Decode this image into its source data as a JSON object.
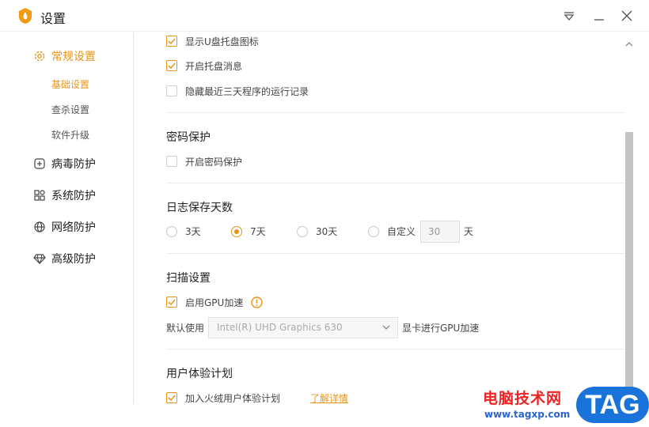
{
  "window": {
    "title": "设置",
    "menu_icon": "menu-triangle-icon",
    "minimize_icon": "minimize-icon",
    "close_icon": "close-icon"
  },
  "sidebar": {
    "items": [
      {
        "label": "常规设置",
        "icon": "gear-icon",
        "active": true
      },
      {
        "label": "病毒防护",
        "icon": "plus-square-icon"
      },
      {
        "label": "系统防护",
        "icon": "grid-icon"
      },
      {
        "label": "网络防护",
        "icon": "globe-icon"
      },
      {
        "label": "高级防护",
        "icon": "diamond-icon"
      }
    ],
    "subitems": [
      {
        "label": "基础设置",
        "active": true
      },
      {
        "label": "查杀设置"
      },
      {
        "label": "软件升级"
      }
    ]
  },
  "content": {
    "top_options": [
      {
        "label": "显示U盘托盘图标",
        "checked": true
      },
      {
        "label": "开启托盘消息",
        "checked": true
      },
      {
        "label": "隐藏最近三天程序的运行记录",
        "checked": false
      }
    ],
    "password": {
      "title": "密码保护",
      "option": {
        "label": "开启密码保护",
        "checked": false
      }
    },
    "log": {
      "title": "日志保存天数",
      "options": [
        {
          "label": "3天",
          "selected": false
        },
        {
          "label": "7天",
          "selected": true
        },
        {
          "label": "30天",
          "selected": false
        },
        {
          "label": "自定义",
          "selected": false
        }
      ],
      "custom_value": "30",
      "custom_unit": "天"
    },
    "scan": {
      "title": "扫描设置",
      "gpu_option": {
        "label": "启用GPU加速",
        "checked": true
      },
      "default_use_label": "默认使用",
      "gpu_select_value": "Intel(R) UHD Graphics 630",
      "gpu_suffix": "显卡进行GPU加速"
    },
    "ux": {
      "title": "用户体验计划",
      "option": {
        "label": "加入火绒用户体验计划",
        "checked": true
      },
      "link": "了解详情"
    }
  },
  "watermark": {
    "text": "电脑技术网",
    "url": "www.tagxp.com",
    "badge": "TAG"
  },
  "colors": {
    "accent": "#e8941a",
    "watermark_red": "#e22222",
    "watermark_blue": "#1a73d9"
  }
}
